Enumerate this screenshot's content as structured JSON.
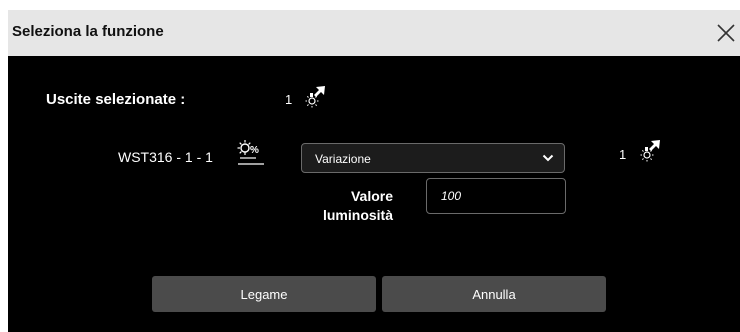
{
  "dialog": {
    "title": "Seleziona la funzione",
    "close_icon": "close-icon"
  },
  "selected_outputs": {
    "label": "Uscite selezionate :",
    "count": "1",
    "icon": "light-output-icon"
  },
  "device_row": {
    "name": "WST316 - 1 - 1",
    "device_icon": "dimmer-percent-icon",
    "function_select": {
      "value": "Variazione",
      "icon": "chevron-down-icon"
    },
    "count": "1",
    "icon": "light-output-icon"
  },
  "brightness": {
    "label_line1": "Valore",
    "label_line2": "luminosità",
    "value": "100"
  },
  "buttons": {
    "link_label": "Legame",
    "cancel_label": "Annulla"
  },
  "colors": {
    "titlebar": "#e6e6e6",
    "background": "#000000",
    "button": "#4b4b4b",
    "field_border": "#6a6a6a"
  }
}
